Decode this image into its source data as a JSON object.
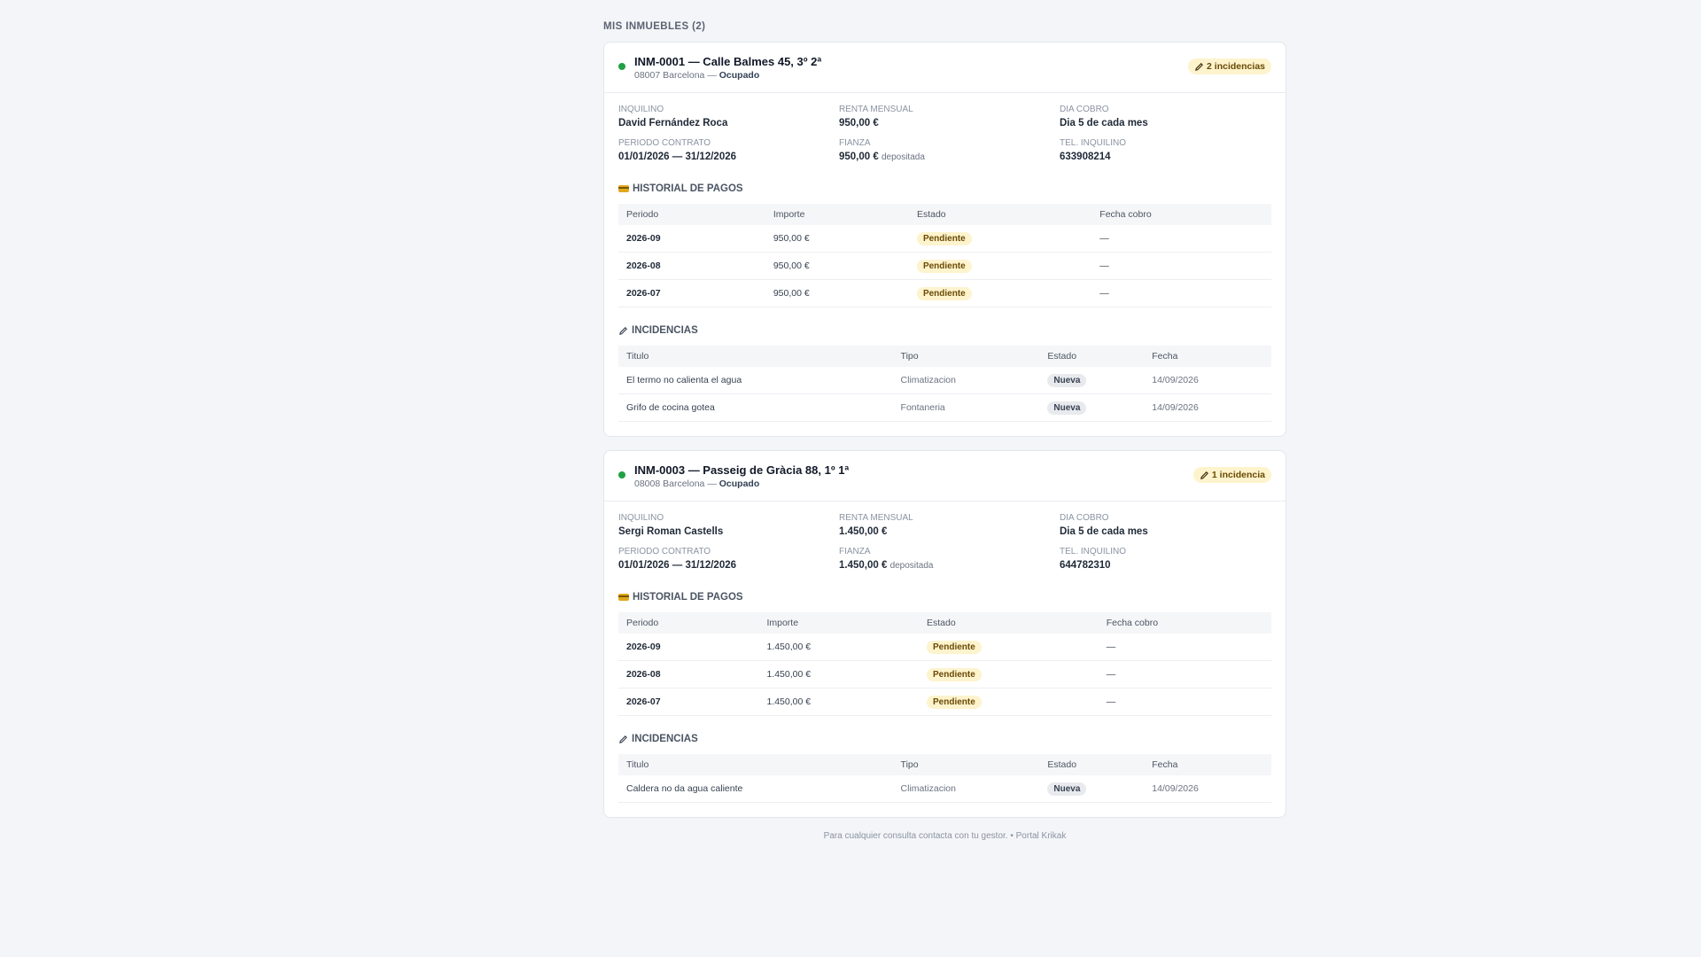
{
  "page": {
    "section_title": "MIS INMUEBLES (2)",
    "footer": "Para cualquier consulta contacta con tu gestor. • Portal Krikak"
  },
  "properties": [
    {
      "title": "INM-0001 — Calle Balmes 45, 3º 2ª",
      "postal_city": "08007 Barcelona —",
      "status": "Ocupado",
      "incidents_badge": "2 incidencias",
      "info": {
        "tenant_label": "INQUILINO",
        "tenant": "David Fernández Roca",
        "rent_label": "RENTA MENSUAL",
        "rent": "950,00 €",
        "payday_label": "DIA COBRO",
        "payday": "Dia 5 de cada mes",
        "contract_label": "PERIODO CONTRATO",
        "contract": "01/01/2026 — 31/12/2026",
        "deposit_label": "FIANZA",
        "deposit": "950,00 €",
        "deposit_note": "depositada",
        "phone_label": "TEL. INQUILINO",
        "phone": "633908214"
      },
      "payments_title": "HISTORIAL DE PAGOS",
      "payments_headers": [
        "Periodo",
        "Importe",
        "Estado",
        "Fecha cobro"
      ],
      "payments": [
        {
          "period": "2026-09",
          "amount": "950,00 €",
          "status": "Pendiente",
          "date": "—"
        },
        {
          "period": "2026-08",
          "amount": "950,00 €",
          "status": "Pendiente",
          "date": "—"
        },
        {
          "period": "2026-07",
          "amount": "950,00 €",
          "status": "Pendiente",
          "date": "—"
        }
      ],
      "incidents_title": "INCIDENCIAS",
      "incidents_headers": [
        "Titulo",
        "Tipo",
        "Estado",
        "Fecha"
      ],
      "incidents": [
        {
          "title": "El termo no calienta el agua",
          "type": "Climatizacion",
          "status": "Nueva",
          "date": "14/09/2026"
        },
        {
          "title": "Grifo de cocina gotea",
          "type": "Fontaneria",
          "status": "Nueva",
          "date": "14/09/2026"
        }
      ]
    },
    {
      "title": "INM-0003 — Passeig de Gràcia 88, 1º 1ª",
      "postal_city": "08008 Barcelona —",
      "status": "Ocupado",
      "incidents_badge": "1 incidencia",
      "info": {
        "tenant_label": "INQUILINO",
        "tenant": "Sergi Roman Castells",
        "rent_label": "RENTA MENSUAL",
        "rent": "1.450,00 €",
        "payday_label": "DIA COBRO",
        "payday": "Dia 5 de cada mes",
        "contract_label": "PERIODO CONTRATO",
        "contract": "01/01/2026 — 31/12/2026",
        "deposit_label": "FIANZA",
        "deposit": "1.450,00 €",
        "deposit_note": "depositada",
        "phone_label": "TEL. INQUILINO",
        "phone": "644782310"
      },
      "payments_title": "HISTORIAL DE PAGOS",
      "payments_headers": [
        "Periodo",
        "Importe",
        "Estado",
        "Fecha cobro"
      ],
      "payments": [
        {
          "period": "2026-09",
          "amount": "1.450,00 €",
          "status": "Pendiente",
          "date": "—"
        },
        {
          "period": "2026-08",
          "amount": "1.450,00 €",
          "status": "Pendiente",
          "date": "—"
        },
        {
          "period": "2026-07",
          "amount": "1.450,00 €",
          "status": "Pendiente",
          "date": "—"
        }
      ],
      "incidents_title": "INCIDENCIAS",
      "incidents_headers": [
        "Titulo",
        "Tipo",
        "Estado",
        "Fecha"
      ],
      "incidents": [
        {
          "title": "Caldera no da agua caliente",
          "type": "Climatizacion",
          "status": "Nueva",
          "date": "14/09/2026"
        }
      ]
    }
  ]
}
